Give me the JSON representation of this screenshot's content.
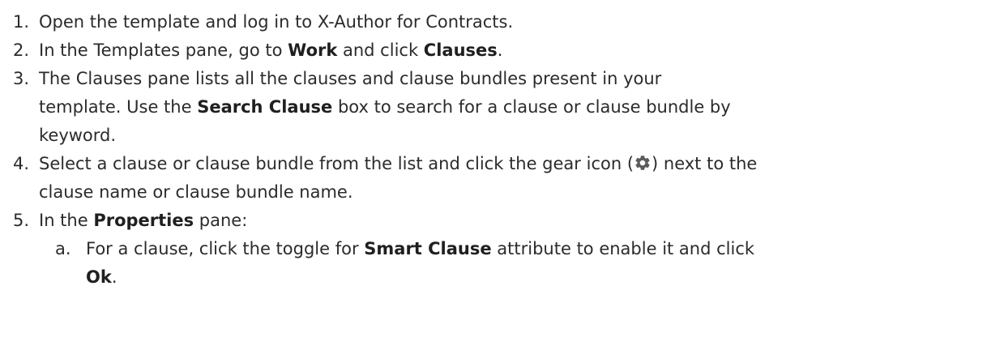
{
  "steps": [
    {
      "num": "1.",
      "text": "Open the template and log in to X-Author for Contracts."
    },
    {
      "num": "2.",
      "p1": "In the Templates pane, go to ",
      "b1": "Work",
      "p2": " and click ",
      "b2": "Clauses",
      "p3": "."
    },
    {
      "num": "3.",
      "p1": "The Clauses pane lists all the clauses and clause bundles present in your",
      "p2": "template. Use the ",
      "b1": "Search Clause",
      "p3": " box to search for a clause or clause bundle by",
      "p4": "keyword."
    },
    {
      "num": "4.",
      "p1": "Select a clause or clause bundle from the list and click the gear icon (",
      "p2": ") next to the",
      "p3": "clause name or clause bundle name."
    },
    {
      "num": "5.",
      "p1": "In the ",
      "b1": "Properties",
      "p2": " pane:",
      "sub": [
        {
          "num": "a.",
          "p1": "For a clause, click the toggle for ",
          "b1": "Smart Clause",
          "p2": " attribute to enable it and click",
          "b2": "Ok",
          "p3": "."
        }
      ]
    }
  ],
  "icons": {
    "gear": "gear-icon",
    "gear_color": "#5b5b5b"
  }
}
